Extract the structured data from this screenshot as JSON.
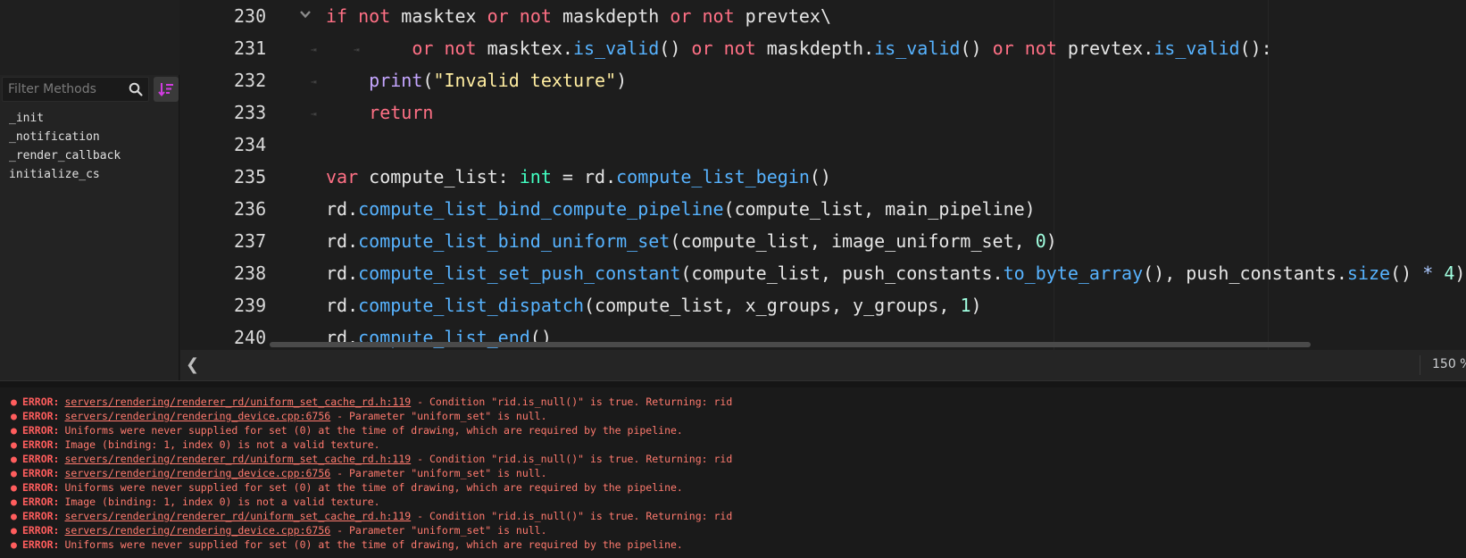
{
  "methods_panel": {
    "filter_placeholder": "Filter Methods",
    "items": [
      "_init",
      "_notification",
      "_render_callback",
      "initialize_cs"
    ],
    "sort_icon_color": "#d13ce0"
  },
  "editor": {
    "line_numbers": [
      "230",
      "231",
      "232",
      "233",
      "234",
      "235",
      "236",
      "237",
      "238",
      "239",
      "240"
    ],
    "zoom": "150 %",
    "collapse_glyph": "❮"
  },
  "output": {
    "tag": "ERROR:",
    "lines": [
      {
        "link": "servers/rendering/renderer_rd/uniform_set_cache_rd.h:119",
        "text": " - Condition \"rid.is_null()\" is true. Returning: rid"
      },
      {
        "link": "servers/rendering/rendering_device.cpp:6756",
        "text": " - Parameter \"uniform_set\" is null."
      },
      {
        "link": "",
        "text": "Uniforms were never supplied for set (0) at the time of drawing, which are required by the pipeline."
      },
      {
        "link": "",
        "text": "Image (binding: 1, index 0) is not a valid texture."
      },
      {
        "link": "servers/rendering/renderer_rd/uniform_set_cache_rd.h:119",
        "text": " - Condition \"rid.is_null()\" is true. Returning: rid"
      },
      {
        "link": "servers/rendering/rendering_device.cpp:6756",
        "text": " - Parameter \"uniform_set\" is null."
      },
      {
        "link": "",
        "text": "Uniforms were never supplied for set (0) at the time of drawing, which are required by the pipeline."
      },
      {
        "link": "",
        "text": "Image (binding: 1, index 0) is not a valid texture."
      },
      {
        "link": "servers/rendering/renderer_rd/uniform_set_cache_rd.h:119",
        "text": " - Condition \"rid.is_null()\" is true. Returning: rid"
      },
      {
        "link": "servers/rendering/rendering_device.cpp:6756",
        "text": " - Parameter \"uniform_set\" is null."
      },
      {
        "link": "",
        "text": "Uniforms were never supplied for set (0) at the time of drawing, which are required by the pipeline."
      }
    ]
  },
  "colors": {
    "keyword": "#ff7085",
    "function": "#57b3ff",
    "builtin": "#c5a6ff",
    "type": "#42ffc2",
    "string": "#ffeda1",
    "number": "#a1ffe0",
    "error": "#ff5d5d"
  }
}
